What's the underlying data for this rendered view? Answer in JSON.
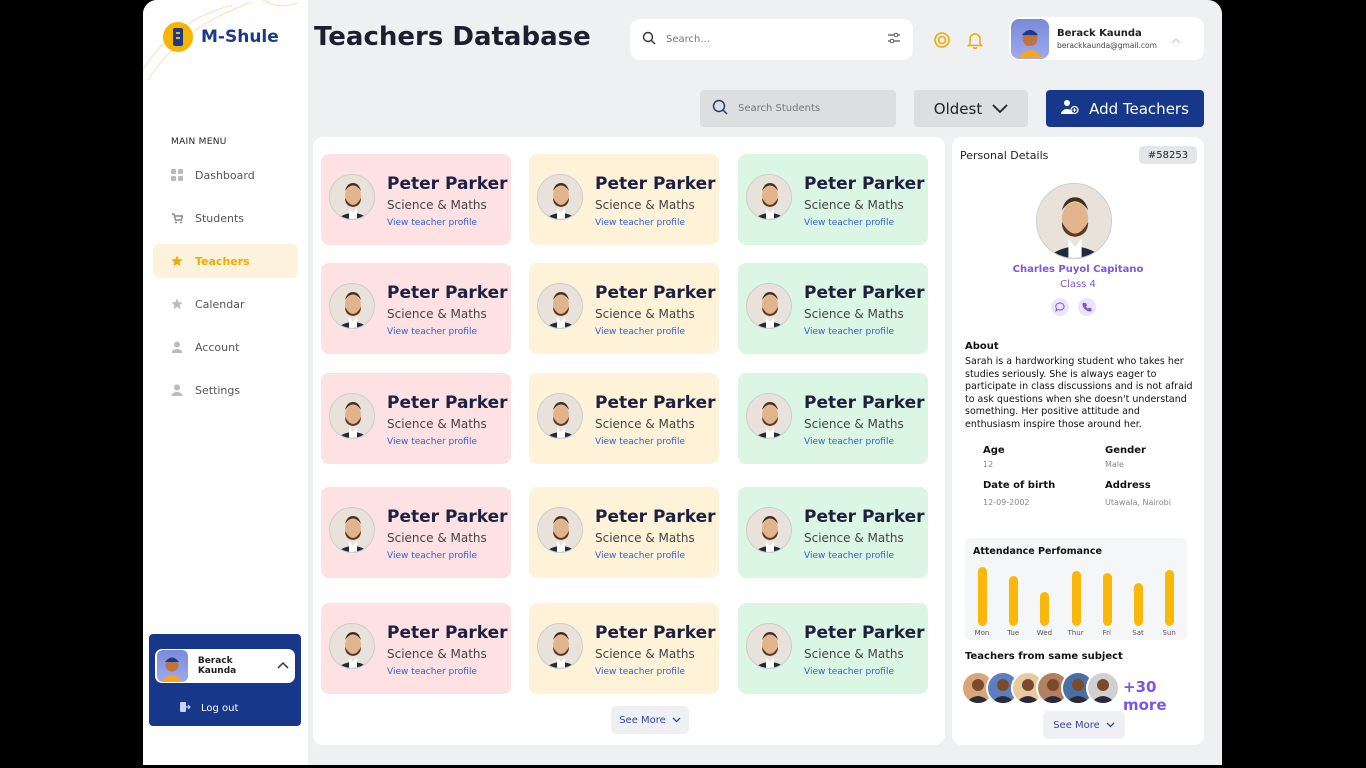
{
  "app": {
    "name": "M-Shule",
    "page_title": "Teachers Database",
    "brand_color": "#17388a",
    "accent_color": "#f7b500"
  },
  "header": {
    "search_placeholder": "Search...",
    "user_name": "Berack Kaunda",
    "user_email": "berackkaunda@gmail.com"
  },
  "sidebar": {
    "menu_title": "MAIN MENU",
    "items": [
      {
        "label": "Dashboard",
        "icon": "grid-icon",
        "active": false
      },
      {
        "label": "Students",
        "icon": "cart-icon",
        "active": false
      },
      {
        "label": "Teachers",
        "icon": "star-icon",
        "active": true
      },
      {
        "label": "Calendar",
        "icon": "star-icon",
        "active": false
      },
      {
        "label": "Account",
        "icon": "user-icon",
        "active": false
      },
      {
        "label": "Settings",
        "icon": "user-icon",
        "active": false
      }
    ],
    "user_name": "Berack Kaunda",
    "logout_label": "Log out"
  },
  "toolbar": {
    "search_placeholder": "Search Students",
    "sort_label": "Oldest",
    "add_label": "Add Teachers"
  },
  "teacher_card": {
    "name": "Peter Parker",
    "subject": "Science & Maths",
    "link": "View teacher profile"
  },
  "grid": {
    "see_more": "See More"
  },
  "details": {
    "title": "Personal Details",
    "id": "#58253",
    "name": "Charles Puyol Capitano",
    "class": "Class 4",
    "about_title": "About",
    "about": "Sarah is a hardworking student who takes her studies seriously. She is always eager to participate in class discussions and is not afraid to ask questions when she doesn't understand something. Her positive attitude and enthusiasm inspire those around her.",
    "age_label": "Age",
    "age": "12",
    "gender_label": "Gender",
    "gender": "Male",
    "dob_label": "Date of birth",
    "dob": "12-09-2002",
    "address_label": "Address",
    "address": "Utawala, Nairobi",
    "attendance_title": "Attendance Perfomance",
    "same_subject_title": "Teachers from same subject",
    "more_count": "+30 more",
    "see_more": "See More"
  },
  "chart_data": {
    "type": "bar",
    "title": "Attendance Perfomance",
    "categories": [
      "Mon",
      "Tue",
      "Wed",
      "Thur",
      "Fri",
      "Sat",
      "Sun"
    ],
    "values": [
      95,
      80,
      55,
      88,
      85,
      70,
      90
    ],
    "ylim": [
      0,
      100
    ],
    "grid": false,
    "color": "#fbb70a"
  }
}
